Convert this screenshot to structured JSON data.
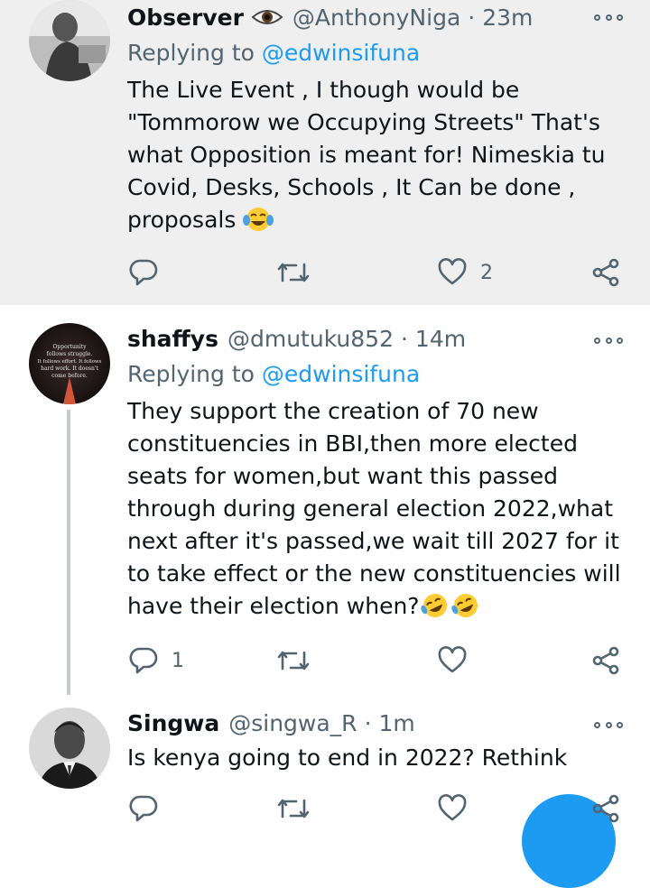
{
  "tweets": [
    {
      "name": "Observer",
      "name_emoji": "eye-emoji",
      "handle": "@AnthonyNiga",
      "separator": "·",
      "time": "23m",
      "replying_label": "Replying to",
      "replying_handle": "@edwinsifuna",
      "text": "The Live Event , I though would be \"Tommorow we Occupying Streets\" That's what Opposition is meant for! Nimeskia tu Covid, Desks, Schools , It Can be done , proposals",
      "text_emoji": "tears-of-joy-emoji",
      "reply_count": "",
      "retweet_count": "",
      "like_count": "2"
    },
    {
      "name": "shaffys",
      "handle": "@dmutuku852",
      "separator": "·",
      "time": "14m",
      "replying_label": "Replying to",
      "replying_handle": "@edwinsifuna",
      "text": "They support the creation of 70 new constituencies in BBI,then more elected seats for women,but want this passed through during general election 2022,what next after it's passed,we wait till 2027 for it to take effect or the new constituencies will have their election when?",
      "text_emoji": "rolling-on-floor-laughing-emoji x2",
      "avatar_text": [
        "Opportunity",
        "follows struggle.",
        "It follows effort. It follows",
        "hard work. It doesn't",
        "come before."
      ],
      "reply_count": "1",
      "retweet_count": "",
      "like_count": ""
    },
    {
      "name": "Singwa",
      "handle": "@singwa_R",
      "separator": "·",
      "time": "1m",
      "text": "Is kenya going to end in 2022? Rethink",
      "reply_count": "",
      "retweet_count": "",
      "like_count": ""
    }
  ],
  "icons": {
    "reply": "reply-icon",
    "retweet": "retweet-icon",
    "like": "heart-icon",
    "share": "share-icon",
    "more": "more-options-icon"
  },
  "colors": {
    "accent": "#1d9bf0",
    "secondary_text": "#536471",
    "highlight_bg": "#efefef"
  }
}
